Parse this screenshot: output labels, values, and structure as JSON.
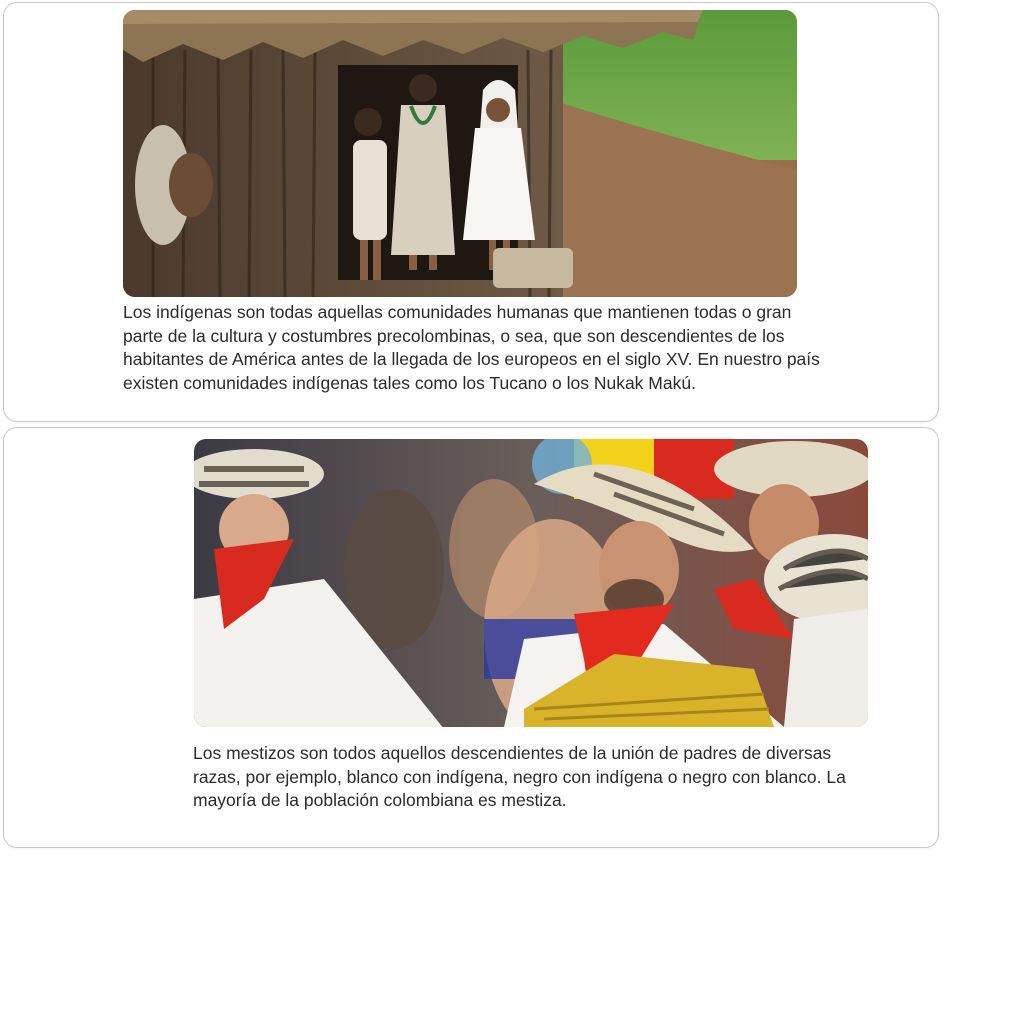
{
  "sections": [
    {
      "image_subject": "indigenous-children-hut-photo",
      "text": "Los indígenas son todas aquellas comunidades humanas que mantienen todas o gran parte de la cultura y costumbres precolombinas, o sea, que son descendientes de los habitantes de América antes de la llegada de los europeos en el siglo XV. En nuestro país existen comunidades indígenas tales como los Tucano o los Nukak Makú."
    },
    {
      "image_subject": "mestizo-festival-photo",
      "text": "Los mestizos son todos aquellos descendientes de la unión de padres de diversas razas, por ejemplo, blanco con indígena, negro con indígena o negro con blanco. La mayoría de la población colombiana es mestiza."
    }
  ],
  "colors": {
    "card_border": "#c9c9c9",
    "text": "#2b2b2b"
  }
}
